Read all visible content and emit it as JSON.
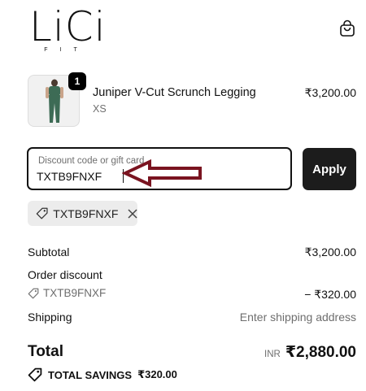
{
  "brand": {
    "logo": "LiCi",
    "logo_sub": "FIT"
  },
  "header": {
    "cart_icon": "shopping-bag-icon"
  },
  "line_item": {
    "quantity": "1",
    "name": "Juniper V-Cut Scrunch Legging",
    "variant": "XS",
    "price": "₹3,200.00",
    "image_color": "#3d6b55"
  },
  "discount": {
    "placeholder": "Discount code or gift card",
    "value": "TXTB9FNXF",
    "apply_label": "Apply",
    "applied_code": "TXTB9FNXF",
    "annotation_color": "#7a1420"
  },
  "summary": {
    "subtotal_label": "Subtotal",
    "subtotal_value": "₹3,200.00",
    "order_discount_label": "Order discount",
    "discount_code": "TXTB9FNXF",
    "discount_value": "− ₹320.00",
    "shipping_label": "Shipping",
    "shipping_value": "Enter shipping address",
    "total_label": "Total",
    "currency": "INR",
    "total_value": "₹2,880.00",
    "savings_label": "TOTAL SAVINGS",
    "savings_value": "₹320.00"
  }
}
